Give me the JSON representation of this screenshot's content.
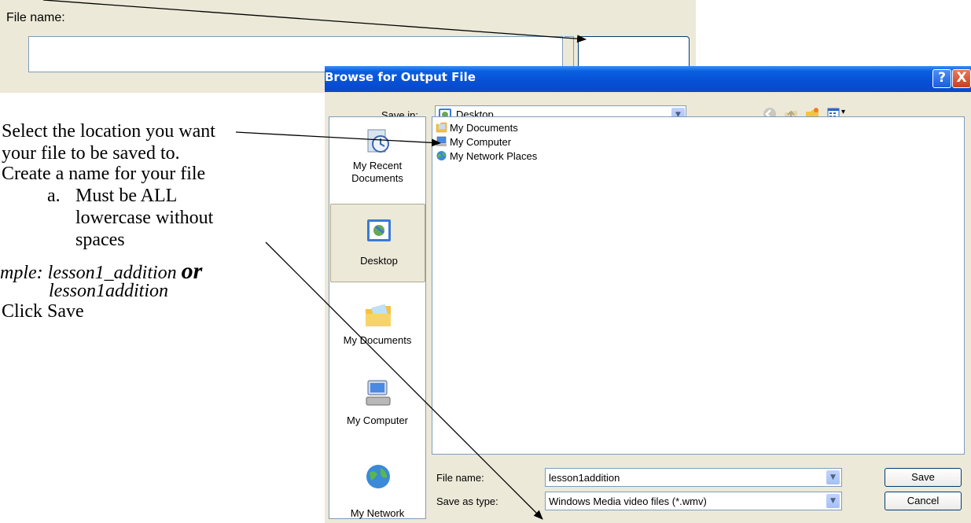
{
  "background_dialog": {
    "file_name_label": "File name:"
  },
  "instructions": {
    "step1_line1": "Select the location you want",
    "step1_line2": "your file to be saved to.",
    "step2": "Create a name for your file",
    "sub_a_marker": "a.",
    "sub_a_line1": "Must be ALL",
    "sub_a_line2": "lowercase without",
    "sub_a_line3": "spaces",
    "example_prefix": "mple: lesson1_addition ",
    "example_or": "or",
    "example_line2": "lesson1addition",
    "step3": "Click Save"
  },
  "dialog": {
    "title": "Browse for Output File",
    "help_label": "?",
    "close_label": "X",
    "save_in_label": "Save in:",
    "save_in_value": "Desktop",
    "places": [
      {
        "label1": "My Recent",
        "label2": "Documents",
        "icon": "recent-documents-icon"
      },
      {
        "label1": "Desktop",
        "label2": "",
        "icon": "desktop-icon"
      },
      {
        "label1": "My Documents",
        "label2": "",
        "icon": "my-documents-folder-icon"
      },
      {
        "label1": "My Computer",
        "label2": "",
        "icon": "my-computer-icon"
      },
      {
        "label1": "My Network",
        "label2": "",
        "icon": "my-network-icon"
      }
    ],
    "files": [
      {
        "name": "My Documents",
        "icon": "folder-icon"
      },
      {
        "name": "My Computer",
        "icon": "computer-icon"
      },
      {
        "name": "My Network Places",
        "icon": "network-icon"
      }
    ],
    "file_name_label": "File name:",
    "file_name_value": "lesson1addition",
    "save_as_type_label": "Save as type:",
    "save_as_type_value": "Windows Media video files (*.wmv)",
    "save_button": "Save",
    "cancel_button": "Cancel"
  },
  "colors": {
    "titlebar": "#0750d6",
    "dialog_bg": "#ece9d8",
    "input_border": "#7f9db9"
  }
}
